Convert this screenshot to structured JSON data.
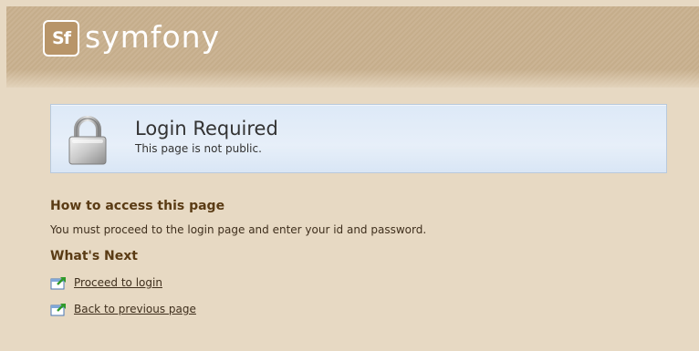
{
  "header": {
    "logo_mark": "Sf",
    "logo_text": "symfony"
  },
  "notice": {
    "icon": "lock-icon",
    "title": "Login Required",
    "subtitle": "This page is not public."
  },
  "content": {
    "access_heading": "How to access this page",
    "access_text": "You must proceed to the login page and enter your id and password.",
    "next_heading": "What's Next",
    "links": [
      {
        "icon": "arrow-link-icon",
        "label": "Proceed to login"
      },
      {
        "icon": "arrow-link-icon",
        "label": "Back to previous page"
      }
    ]
  },
  "colors": {
    "background": "#e7d9c3",
    "header": "#c5ad8b",
    "notice_bg": "#e1ebf7",
    "notice_border": "#b8c9dd",
    "heading": "#5a3b14"
  }
}
